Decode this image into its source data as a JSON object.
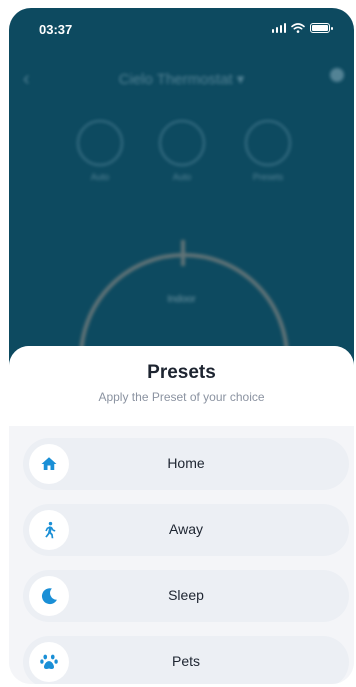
{
  "status_bar": {
    "time": "03:37"
  },
  "background": {
    "device_name": "Cielo Thermostat ▾",
    "modes": [
      "Auto",
      "Auto",
      "Presets"
    ],
    "dial_label": "Indoor"
  },
  "sheet": {
    "title": "Presets",
    "subtitle": "Apply the Preset of your choice",
    "items": [
      {
        "label": "Home",
        "icon": "home-icon"
      },
      {
        "label": "Away",
        "icon": "walking-person-icon"
      },
      {
        "label": "Sleep",
        "icon": "moon-icon"
      },
      {
        "label": "Pets",
        "icon": "paw-icon"
      }
    ]
  },
  "colors": {
    "accent": "#1a8fd6",
    "background_screen": "#0d4a60",
    "sheet_bg": "#f4f5f8",
    "item_bg": "#eceff4"
  }
}
